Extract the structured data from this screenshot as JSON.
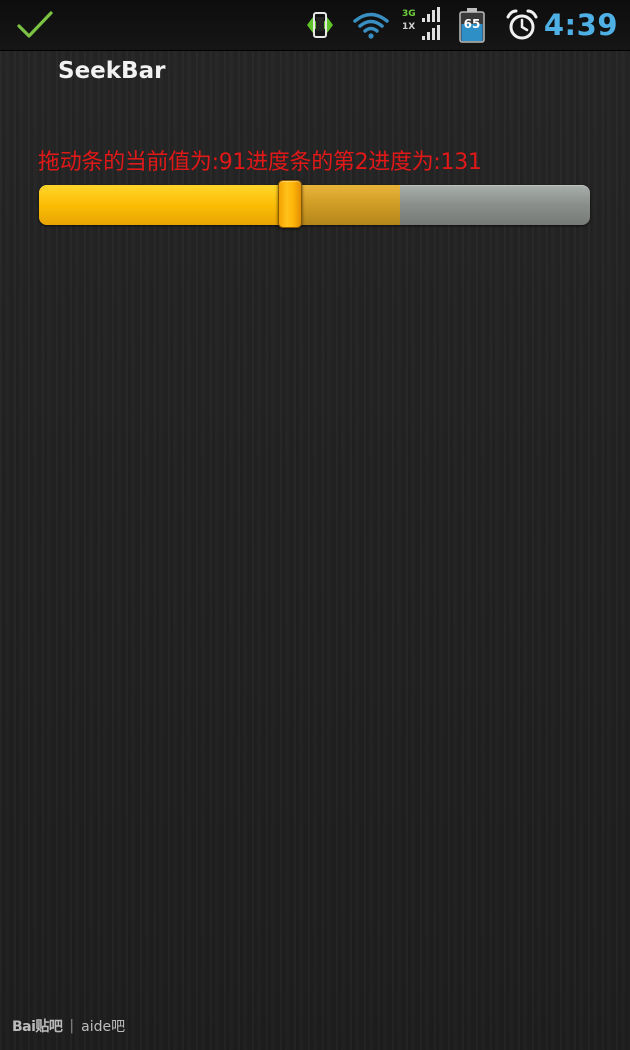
{
  "status_bar": {
    "network_top": "3G",
    "network_bottom": "1X",
    "battery_level": "65",
    "time": "4:39",
    "icons": [
      "check-icon",
      "debug-icon",
      "wifi-icon",
      "signal-icon",
      "battery-icon",
      "alarm-icon"
    ]
  },
  "app": {
    "title": "SeekBar"
  },
  "progress_text": "拖动条的当前值为:91进度条的第2进度为:131",
  "seekbar": {
    "max": 200,
    "progress": 91,
    "secondary_progress": 131
  },
  "watermark": {
    "brand": "Bai贴吧",
    "separator": "|",
    "site": "aide吧"
  },
  "colors": {
    "clock": "#4fb0e6",
    "progress_text": "#e01818",
    "check": "#7cc243",
    "seek_primary": "#fbbd05",
    "seek_secondary": "#cf9c24",
    "seek_track": "#8c918d"
  }
}
